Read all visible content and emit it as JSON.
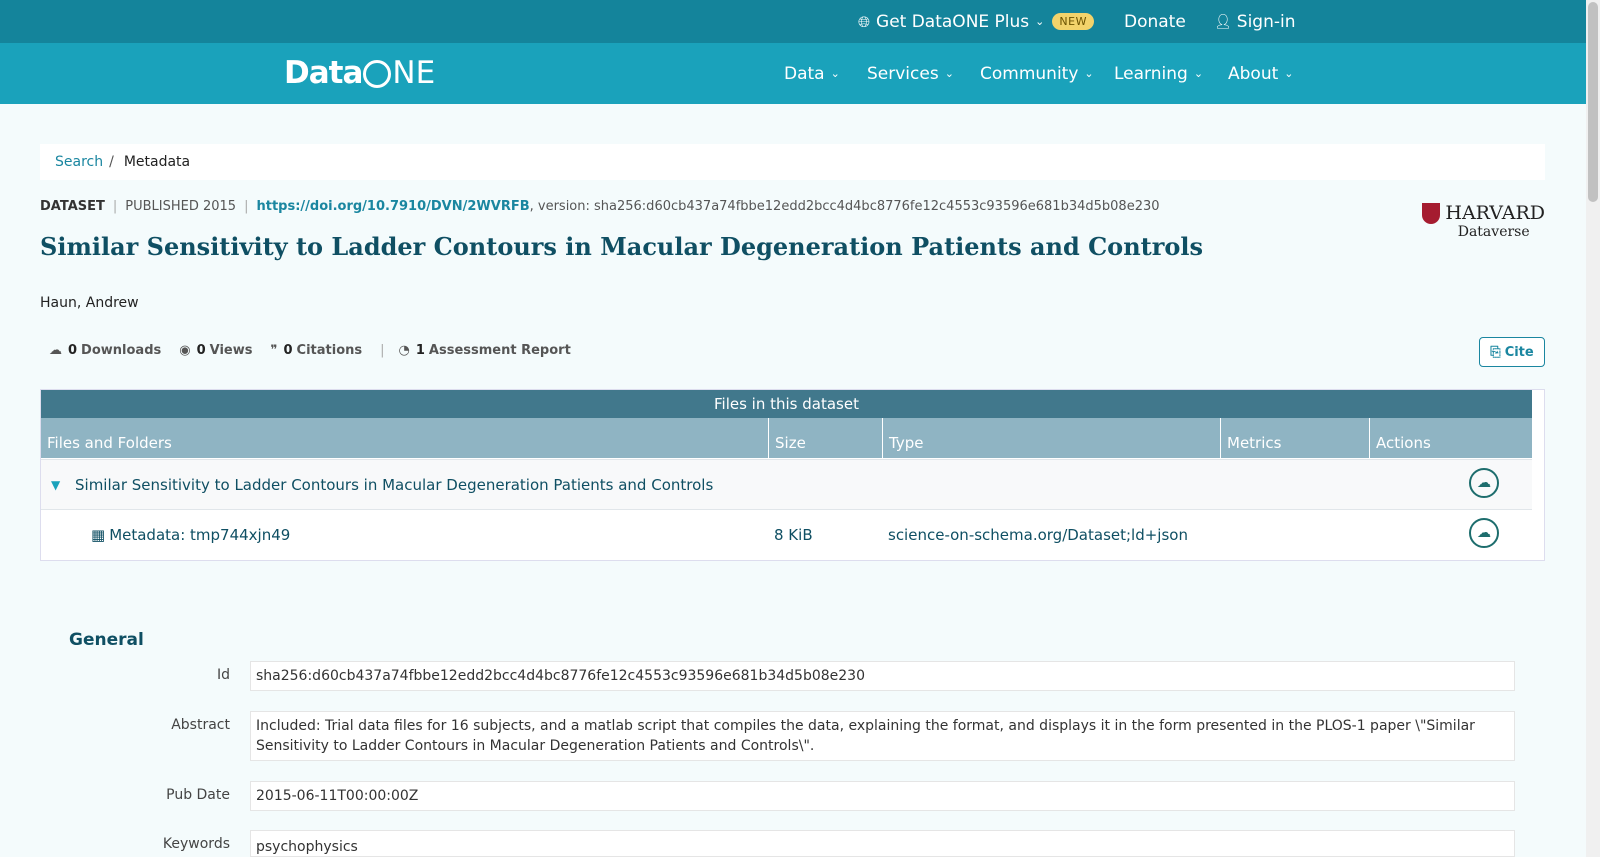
{
  "topbar": {
    "plus_label": "Get DataONE Plus",
    "new_badge": "NEW",
    "donate_label": "Donate",
    "signin_label": "Sign-in"
  },
  "logo": {
    "part1": "Data",
    "part2": "NE"
  },
  "nav": {
    "items": [
      {
        "label": "Data"
      },
      {
        "label": "Services"
      },
      {
        "label": "Community"
      },
      {
        "label": "Learning"
      },
      {
        "label": "About"
      }
    ]
  },
  "breadcrumb": {
    "search": "Search",
    "separator": "/",
    "current": "Metadata"
  },
  "meta": {
    "dataset_label": "DATASET",
    "published": "PUBLISHED 2015",
    "doi": "https://doi.org/10.7910/DVN/2WVRFB",
    "version": ", version: sha256:d60cb437a74fbbe12edd2bcc4d4bc8776fe12c4553c93596e681b34d5b08e230"
  },
  "repository": {
    "name": "HARVARD",
    "subname": "Dataverse"
  },
  "title": "Similar Sensitivity to Ladder Contours in Macular Degeneration Patients and Controls",
  "author": "Haun, Andrew",
  "stats": {
    "downloads_count": "0",
    "downloads_label": "Downloads",
    "views_count": "0",
    "views_label": "Views",
    "citations_count": "0",
    "citations_label": "Citations",
    "assessment_count": "1",
    "assessment_label": "Assessment Report"
  },
  "cite_label": "Cite",
  "files": {
    "heading": "Files in this dataset",
    "columns": [
      "Files and Folders",
      "Size",
      "Type",
      "Metrics",
      "Actions"
    ],
    "folder_name": "Similar Sensitivity to Ladder Contours in Macular Degeneration Patients and Controls",
    "rows": [
      {
        "name": "Metadata: tmp744xjn49",
        "size": "8 KiB",
        "type": "science-on-schema.org/Dataset;ld+json"
      }
    ]
  },
  "general": {
    "heading": "General",
    "id_label": "Id",
    "id_value": "sha256:d60cb437a74fbbe12edd2bcc4d4bc8776fe12c4553c93596e681b34d5b08e230",
    "abstract_label": "Abstract",
    "abstract_value": "Included: Trial data files for 16 subjects, and a matlab script that compiles the data, explaining the format, and displays it in the form presented in the PLOS-1 paper \\\"Similar Sensitivity to Ladder Contours in Macular Degeneration Patients and Controls\\\".",
    "pubdate_label": "Pub Date",
    "pubdate_value": "2015-06-11T00:00:00Z",
    "keywords_label": "Keywords",
    "keywords_value": "psychophysics"
  }
}
